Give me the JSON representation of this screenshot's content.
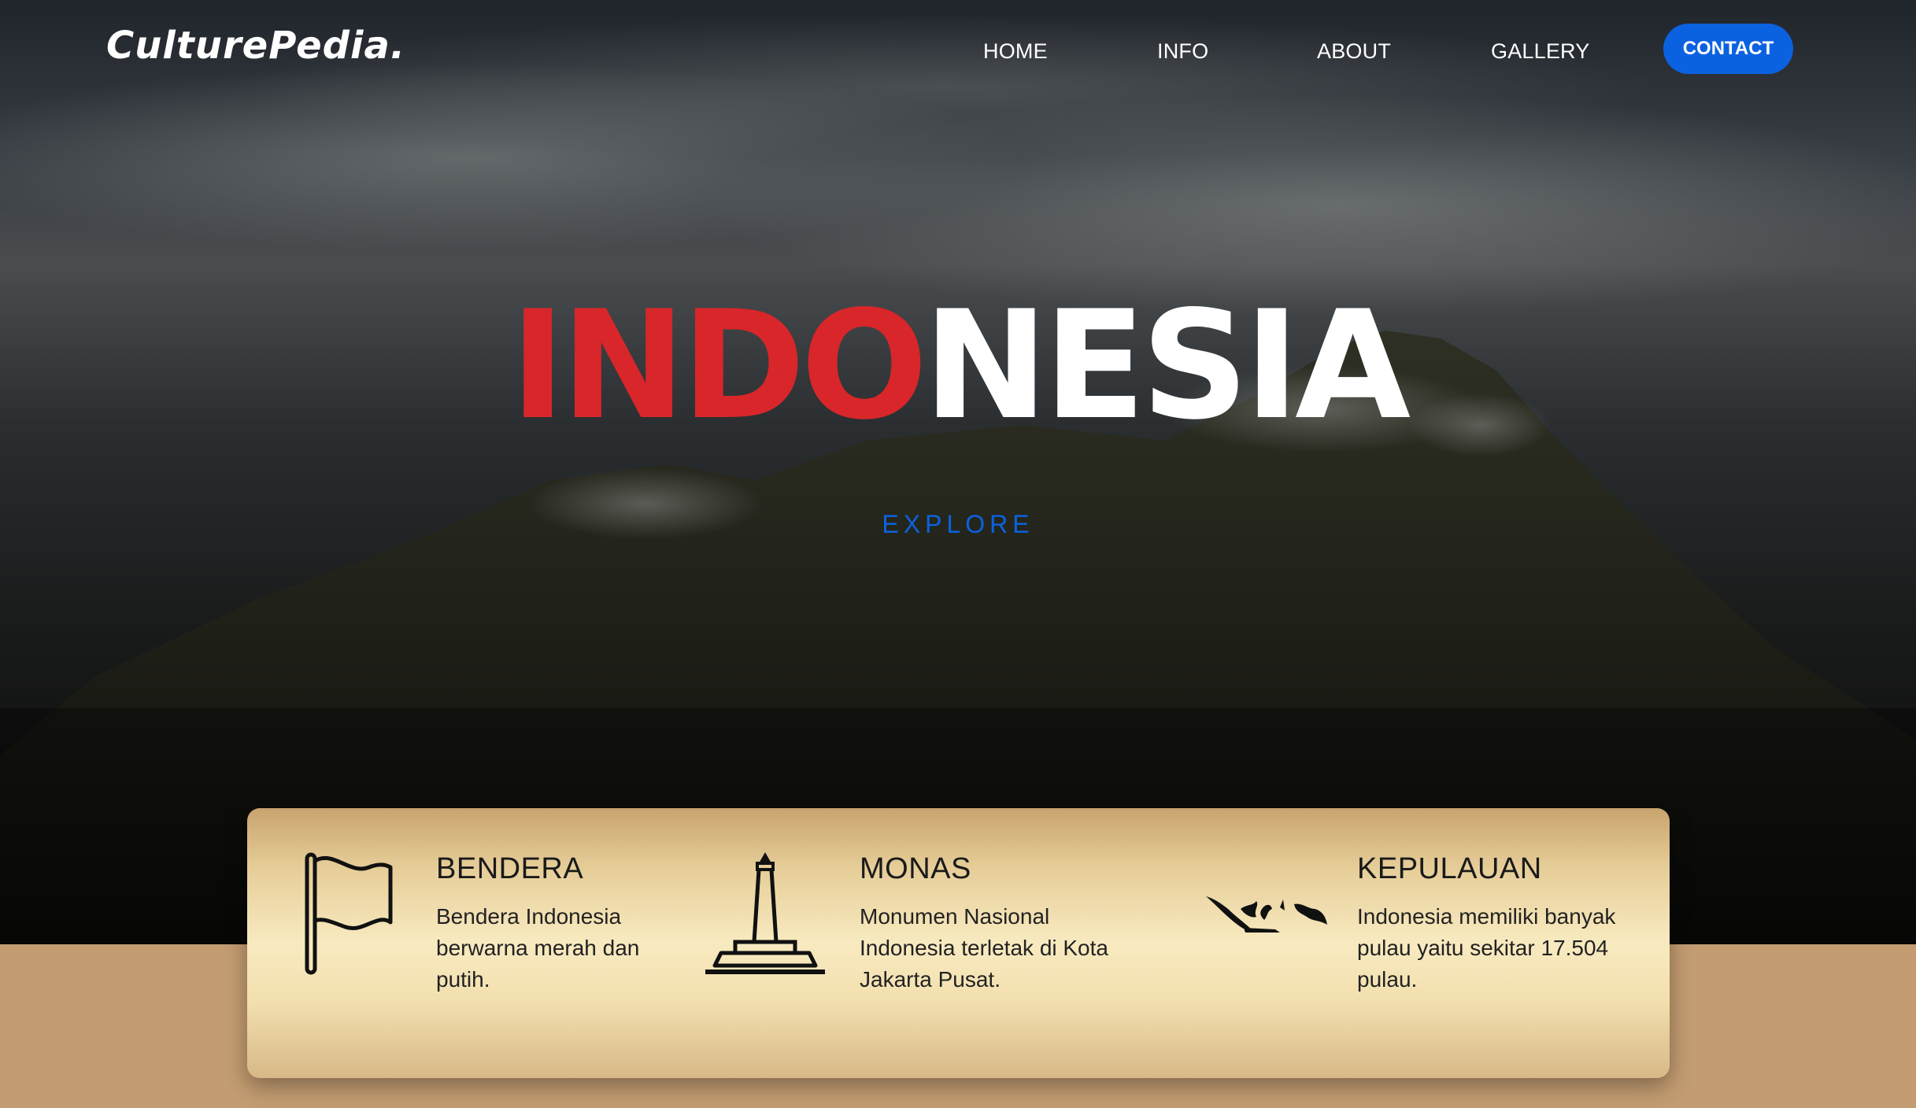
{
  "brand": {
    "logo": "CulturePedia."
  },
  "nav": {
    "items": [
      {
        "label": "HOME"
      },
      {
        "label": "INFO"
      },
      {
        "label": "ABOUT"
      },
      {
        "label": "GALLERY"
      }
    ],
    "contact_label": "CONTACT"
  },
  "hero": {
    "title_red": "INDO",
    "title_white": "NESIA",
    "explore_label": "EXPLORE"
  },
  "features": [
    {
      "icon": "flag-icon",
      "title": "BENDERA",
      "text": "Bendera Indonesia berwarna merah dan putih."
    },
    {
      "icon": "monument-icon",
      "title": "MONAS",
      "text": "Monumen Nasional Indonesia terletak di Kota Jakarta Pusat."
    },
    {
      "icon": "archipelago-map-icon",
      "title": "KEPULAUAN",
      "text": "Indonesia memiliki banyak pulau yaitu sekitar 17.504 pulau."
    }
  ],
  "colors": {
    "accent_blue": "#0b62e0",
    "title_red": "#d8262a",
    "footer_tan": "#c39c71"
  }
}
